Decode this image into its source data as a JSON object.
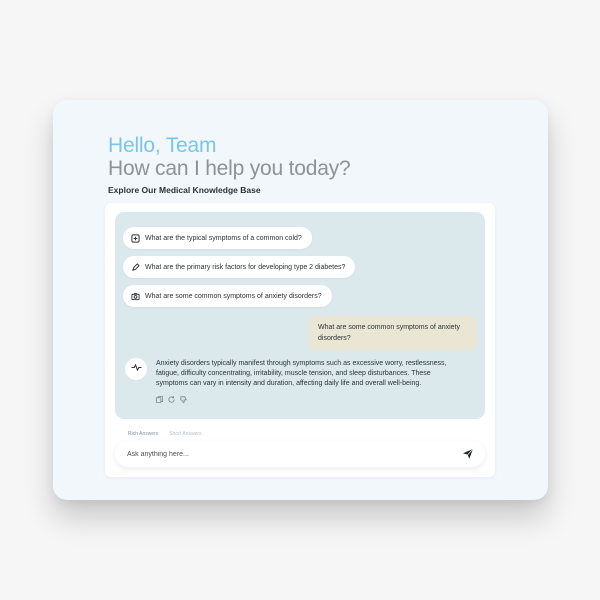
{
  "greeting": {
    "hello": "Hello, Team",
    "subtitle": "How can I help you today?",
    "explore": "Explore Our Medical Knowledge Base"
  },
  "suggestions": [
    {
      "icon": "plus-square-icon",
      "label": "What are the typical symptoms of a common cold?"
    },
    {
      "icon": "pencil-icon",
      "label": "What are the primary risk factors for developing type 2 diabetes?"
    },
    {
      "icon": "camera-icon",
      "label": "What are some common symptoms of anxiety disorders?"
    }
  ],
  "conversation": {
    "user_message": "What are some common symptoms of anxiety disorders?",
    "bot_avatar_icon": "pulse-icon",
    "bot_message": "Anxiety disorders typically manifest through symptoms such as excessive worry, restlessness, fatigue, difficulty concentrating, irritability, muscle tension, and sleep disturbances. These symptoms can vary in intensity and duration, affecting daily life and overall well-being.",
    "actions": [
      "copy-icon",
      "refresh-icon",
      "thumbs-down-icon"
    ]
  },
  "answer_modes": {
    "rich": "Rich Answers",
    "short": "Short Answers"
  },
  "composer": {
    "placeholder": "Ask anything here...",
    "send_icon": "send-icon"
  },
  "colors": {
    "accent": "#79c6e8",
    "chat_bg": "#dbe8ec",
    "user_bubble": "#e9e7d3"
  }
}
